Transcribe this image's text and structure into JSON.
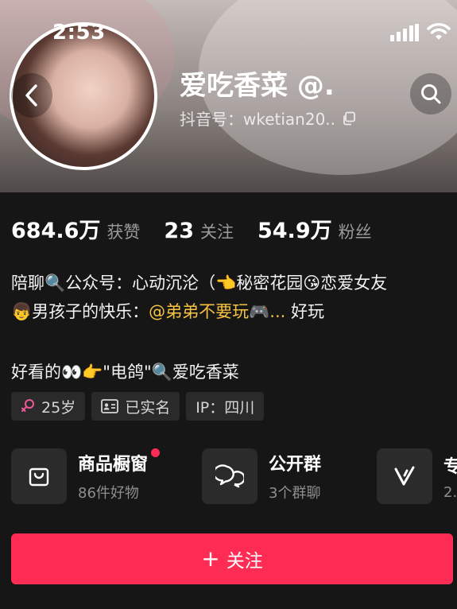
{
  "status_bar": {
    "time": "2:53"
  },
  "profile": {
    "nickname": "爱吃香菜 @.",
    "account_id": "抖音号：wketian20.."
  },
  "stats": [
    {
      "value": "684.6万",
      "label": "获赞"
    },
    {
      "value": "23",
      "label": "关注"
    },
    {
      "value": "54.9万",
      "label": "粉丝"
    }
  ],
  "bio": {
    "line1": "陪聊🔍公众号：心动沉沦（👈秘密花园😘恋爱女友",
    "line2_prefix": "👦男孩子的快乐：",
    "line2_mention": "@弟弟不要玩🎮...",
    "line2_suffix": " 好玩",
    "line3": "好看的👀👉\"电鸽\"🔍爱吃香菜"
  },
  "tags": [
    {
      "icon": "female-icon",
      "text": "25岁"
    },
    {
      "icon": "id-card-icon",
      "text": "已实名"
    },
    {
      "icon": "",
      "text": "IP：四川"
    }
  ],
  "cards": [
    {
      "icon": "shopping-bag-icon",
      "title": "商品橱窗",
      "subtitle": "86件好物"
    },
    {
      "icon": "group-chat-icon",
      "title": "公开群",
      "subtitle": "3个群聊"
    },
    {
      "icon": "v-icon",
      "title": "专",
      "subtitle": "2."
    }
  ],
  "follow_button": {
    "plus": "+",
    "label": "关注"
  },
  "colors": {
    "accent": "#fe2c55",
    "mention": "#f5c242",
    "background": "#161616"
  }
}
